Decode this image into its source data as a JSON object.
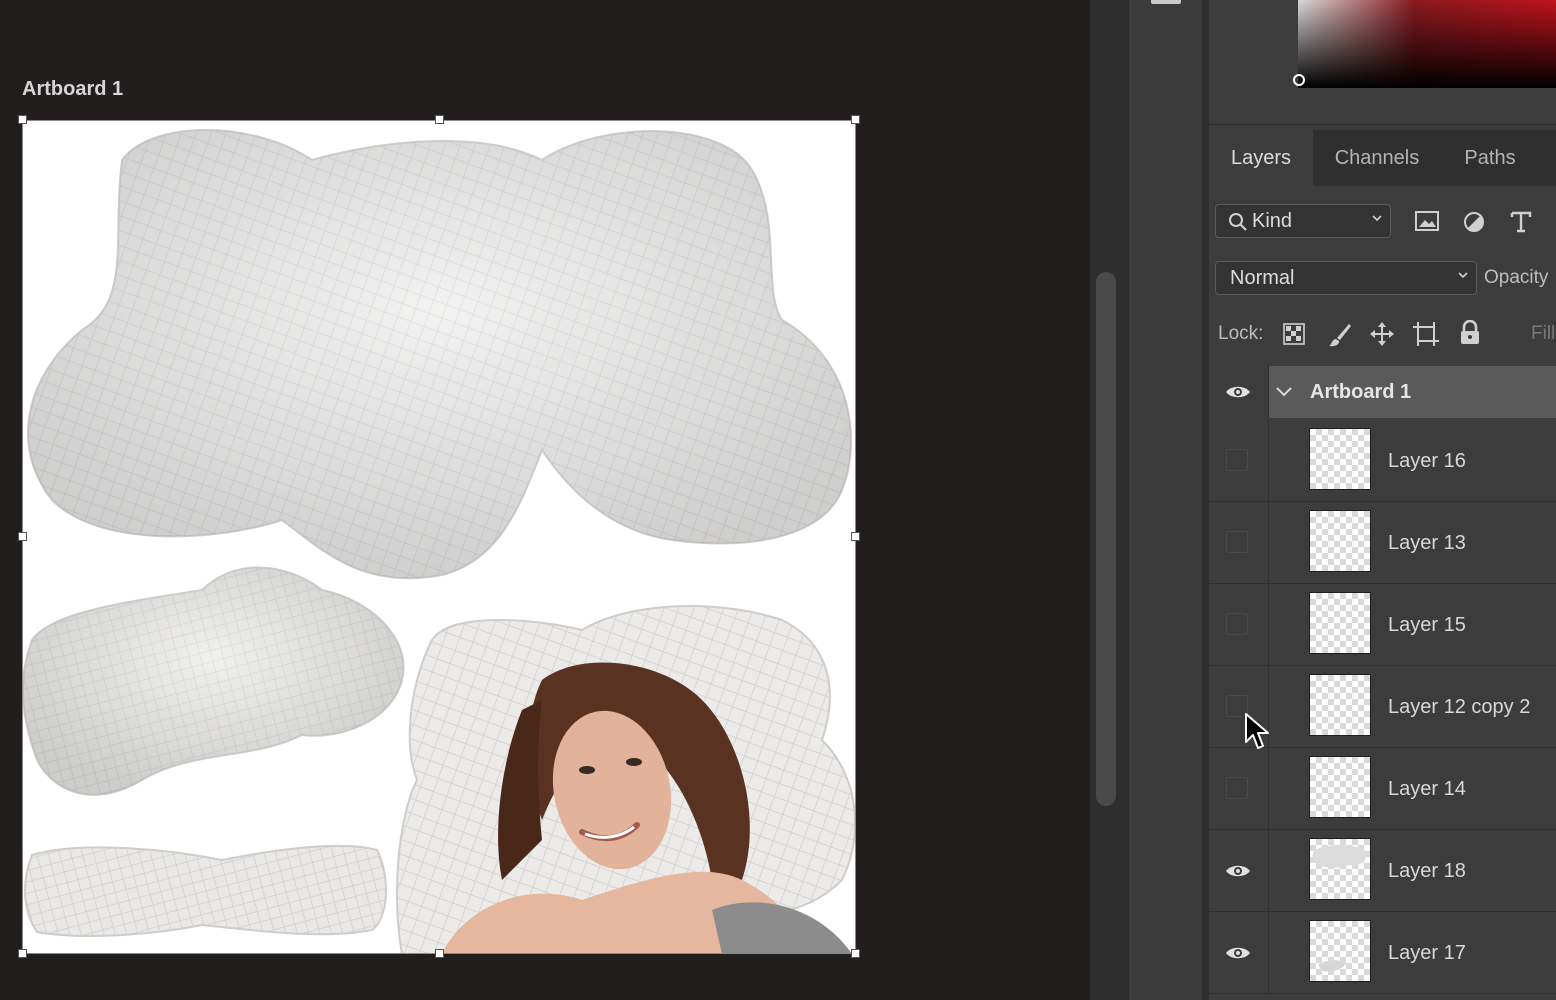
{
  "artboard": {
    "label": "Artboard 1"
  },
  "panel": {
    "tabs": [
      {
        "label": "Layers",
        "active": true
      },
      {
        "label": "Channels",
        "active": false
      },
      {
        "label": "Paths",
        "active": false
      }
    ],
    "filter": {
      "value": "Kind",
      "icons": [
        "image-filter-icon",
        "adjustment-filter-icon",
        "type-filter-icon"
      ]
    },
    "blend_mode": {
      "value": "Normal"
    },
    "opacity_label": "Opacity",
    "lock_label": "Lock:",
    "fill_label": "Fill",
    "lock_icons": [
      "lock-transparent-pixels-icon",
      "lock-image-pixels-icon",
      "lock-position-icon",
      "lock-artboard-icon",
      "lock-all-icon"
    ]
  },
  "layers": {
    "group": {
      "name": "Artboard 1",
      "visible": true,
      "expanded": true
    },
    "items": [
      {
        "name": "Layer 16",
        "visible": false
      },
      {
        "name": "Layer 13",
        "visible": false
      },
      {
        "name": "Layer 15",
        "visible": false
      },
      {
        "name": "Layer 12 copy 2",
        "visible": false
      },
      {
        "name": "Layer 14",
        "visible": false
      },
      {
        "name": "Layer 18",
        "visible": true
      },
      {
        "name": "Layer 17",
        "visible": true
      }
    ]
  },
  "colors": {
    "panel_bg": "#3c3c3c",
    "canvas_bg": "#221e1d",
    "selected_row": "#5a5a5a"
  }
}
